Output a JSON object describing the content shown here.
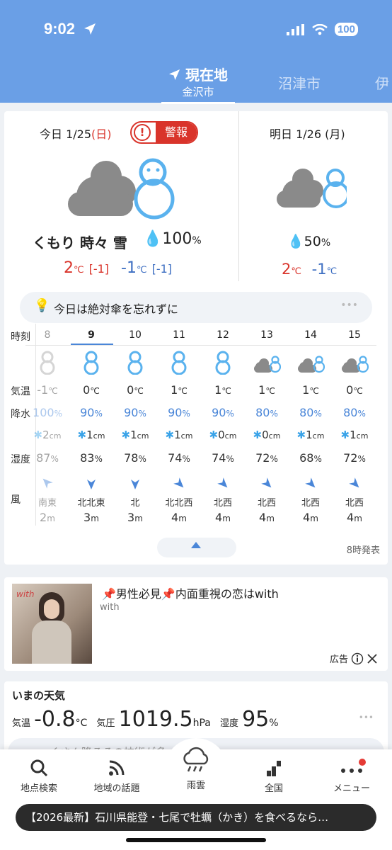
{
  "status": {
    "time": "9:02",
    "battery": "100"
  },
  "locations": {
    "current_label": "現在地",
    "current_city": "金沢市",
    "next": "沼津市",
    "next2": "伊"
  },
  "today": {
    "label": "今日 1/25",
    "weekday": "(日)",
    "alert": "警報",
    "condition": "くもり 時々 雪",
    "precip": "100",
    "high": "2",
    "high_diff": "[-1]",
    "low": "-1",
    "low_diff": "[-1]"
  },
  "tomorrow": {
    "label": "明日 1/26 (月)",
    "precip": "50",
    "high": "2",
    "low": "-1"
  },
  "units": {
    "celsius": "℃",
    "percent": "%"
  },
  "umbrella": {
    "text": "今日は絶対傘を忘れずに",
    "dots": "•••"
  },
  "hourly": {
    "labels": {
      "time": "時刻",
      "temp": "気温",
      "precip": "降水",
      "humidity": "湿度",
      "wind": "風"
    },
    "hours": [
      {
        "hour": "8",
        "icon": "snowman-icon",
        "temp": "-1",
        "temp_unit": "℃",
        "pop": "100",
        "pop_unit": "%",
        "snow": "2",
        "snow_unit": "cm",
        "hum": "87",
        "hum_unit": "%",
        "wdir": "南東",
        "wspd": "2",
        "wspd_unit": "m"
      },
      {
        "hour": "9",
        "icon": "snowman-icon",
        "temp": "0",
        "temp_unit": "℃",
        "pop": "90",
        "pop_unit": "%",
        "snow": "1",
        "snow_unit": "cm",
        "hum": "83",
        "hum_unit": "%",
        "wdir": "北北東",
        "wspd": "3",
        "wspd_unit": "m"
      },
      {
        "hour": "10",
        "icon": "snowman-icon",
        "temp": "0",
        "temp_unit": "℃",
        "pop": "90",
        "pop_unit": "%",
        "snow": "1",
        "snow_unit": "cm",
        "hum": "78",
        "hum_unit": "%",
        "wdir": "北",
        "wspd": "3",
        "wspd_unit": "m"
      },
      {
        "hour": "11",
        "icon": "snowman-icon",
        "temp": "1",
        "temp_unit": "℃",
        "pop": "90",
        "pop_unit": "%",
        "snow": "1",
        "snow_unit": "cm",
        "hum": "74",
        "hum_unit": "%",
        "wdir": "北北西",
        "wspd": "4",
        "wspd_unit": "m"
      },
      {
        "hour": "12",
        "icon": "snowman-icon",
        "temp": "1",
        "temp_unit": "℃",
        "pop": "90",
        "pop_unit": "%",
        "snow": "0",
        "snow_unit": "cm",
        "hum": "74",
        "hum_unit": "%",
        "wdir": "北西",
        "wspd": "4",
        "wspd_unit": "m"
      },
      {
        "hour": "13",
        "icon": "cloud-snow-icon",
        "temp": "1",
        "temp_unit": "℃",
        "pop": "80",
        "pop_unit": "%",
        "snow": "0",
        "snow_unit": "cm",
        "hum": "72",
        "hum_unit": "%",
        "wdir": "北西",
        "wspd": "4",
        "wspd_unit": "m"
      },
      {
        "hour": "14",
        "icon": "cloud-snow-icon",
        "temp": "1",
        "temp_unit": "℃",
        "pop": "80",
        "pop_unit": "%",
        "snow": "1",
        "snow_unit": "cm",
        "hum": "68",
        "hum_unit": "%",
        "wdir": "北西",
        "wspd": "4",
        "wspd_unit": "m"
      },
      {
        "hour": "15",
        "icon": "cloud-snow-icon",
        "temp": "0",
        "temp_unit": "℃",
        "pop": "80",
        "pop_unit": "%",
        "snow": "1",
        "snow_unit": "cm",
        "hum": "72",
        "hum_unit": "%",
        "wdir": "北西",
        "wspd": "4",
        "wspd_unit": "m"
      }
    ],
    "issued": "8時発表"
  },
  "ad": {
    "title": "📌男性必見📌内面重視の恋はwith",
    "source": "with",
    "label": "広告",
    "logo_text": "with"
  },
  "now": {
    "title": "いまの天気",
    "temp_label": "気温",
    "temp": "-0.8",
    "temp_unit": "°C",
    "pressure_label": "気圧",
    "pressure": "1019.5",
    "pressure_unit": "hPa",
    "hum_label": "湿度",
    "hum": "95",
    "hum_unit": "%"
  },
  "behind_text": "〜くさん降るその技術が多",
  "nav": [
    {
      "label": "地点検索",
      "icon": "search-icon"
    },
    {
      "label": "地域の話題",
      "icon": "rss-icon"
    },
    {
      "label": "雨雲",
      "icon": "rain-cloud-icon"
    },
    {
      "label": "全国",
      "icon": "chart-icon"
    },
    {
      "label": "メニュー",
      "icon": "menu-dots-icon"
    }
  ],
  "ticker": "【2026最新】石川県能登・七尾で牡蠣（かき）を食べるなら…"
}
